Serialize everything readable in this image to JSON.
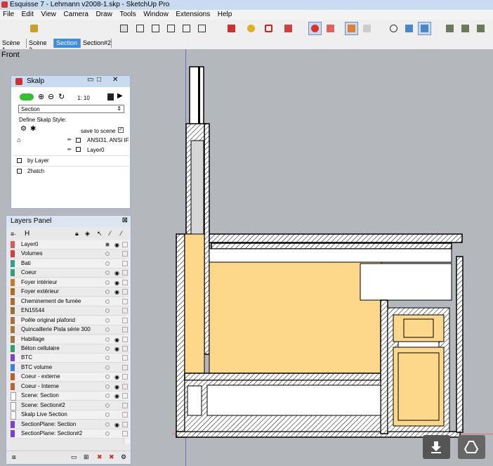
{
  "window": {
    "title": "Esquisse 7 - Lehmann v2008-1.skp - SketchUp Pro"
  },
  "menu": [
    "File",
    "Edit",
    "View",
    "Camera",
    "Draw",
    "Tools",
    "Window",
    "Extensions",
    "Help"
  ],
  "scene_tabs": [
    {
      "label": "Scène 1",
      "selected": false
    },
    {
      "label": "Scène 2",
      "selected": false
    },
    {
      "label": "Section",
      "selected": true
    },
    {
      "label": "Section#2",
      "selected": false
    }
  ],
  "viewport": {
    "view_label": "Front"
  },
  "skalp": {
    "title": "Skalp",
    "scale": "1: 10",
    "style_select": "Section",
    "define_label": "Define Skalp Style:",
    "save_label": "save to scene",
    "rule_pattern": "ANSI31,  ANSI IF",
    "rule_layer": "Layer0",
    "items": [
      "by Layer",
      "2hatch"
    ]
  },
  "layers": {
    "title": "Layers Panel",
    "header": "H",
    "rows": [
      {
        "name": "Layer0",
        "color": "#e05656",
        "eye": true
      },
      {
        "name": "Volumes",
        "color": "#d04040",
        "eye": false
      },
      {
        "name": "Bati",
        "color": "#2f9f8f",
        "eye": false
      },
      {
        "name": "Coeur",
        "color": "#2fa07f",
        "eye": true
      },
      {
        "name": "Foyer intérieur",
        "color": "#c47a2a",
        "eye": true
      },
      {
        "name": "Foyer extérieur",
        "color": "#b86a20",
        "eye": true
      },
      {
        "name": "Cheminement de fumée",
        "color": "#b06a30",
        "eye": false
      },
      {
        "name": "EN15544",
        "color": "#9a7030",
        "eye": false
      },
      {
        "name": "Poêle original plafond",
        "color": "#a97038",
        "eye": false
      },
      {
        "name": "Quincaillerie Pisla série 300",
        "color": "#a07840",
        "eye": false
      },
      {
        "name": "Habillage",
        "color": "#a0783c",
        "eye": true
      },
      {
        "name": "Béton cellulaire",
        "color": "#2f9f6f",
        "eye": true
      },
      {
        "name": "BTC",
        "color": "#7a3fd8",
        "eye": false
      },
      {
        "name": "BTC volume",
        "color": "#3f7fd8",
        "eye": false
      },
      {
        "name": "Coeur - externe",
        "color": "#c65a2a",
        "eye": true
      },
      {
        "name": "Coeur - Interne",
        "color": "#c06030",
        "eye": true
      },
      {
        "name": "Scene: Section",
        "color": "#ffffff",
        "eye": true
      },
      {
        "name": "Scene: Section#2",
        "color": "#ffffff",
        "eye": false
      },
      {
        "name": "Skalp Live Section",
        "color": "#ffffff",
        "eye": false
      },
      {
        "name": "SectionPlane: Section",
        "color": "#7a3fd8",
        "eye": true
      },
      {
        "name": "SectionPlane: Section#2",
        "color": "#7a3fd8",
        "eye": false
      }
    ]
  },
  "colors": {
    "fill": "#fdd88a",
    "accent": "#3b8de0"
  }
}
